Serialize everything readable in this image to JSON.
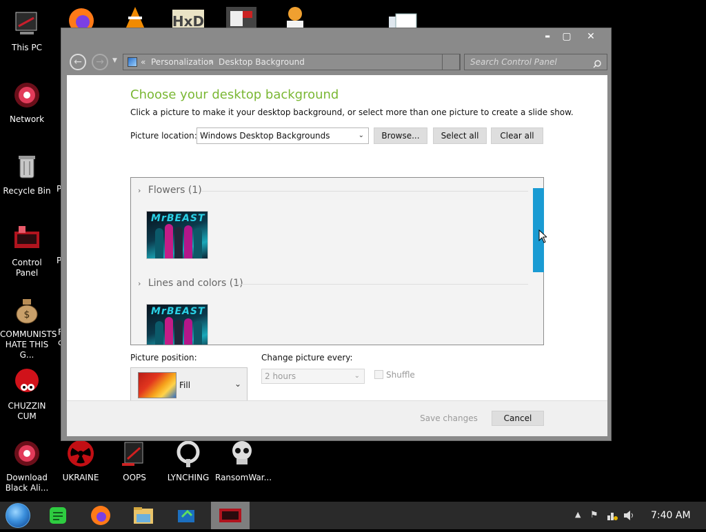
{
  "desktop": {
    "icons": [
      {
        "label": "This PC"
      },
      {
        "label": "Network"
      },
      {
        "label": "Recycle Bin"
      },
      {
        "label": "Control Panel"
      },
      {
        "label": "COMMUNISTS HATE THIS G..."
      },
      {
        "label": "CHUZZIN CUM"
      },
      {
        "label": "Download Black Ali..."
      },
      {
        "label": "UKRAINE"
      },
      {
        "label": "OOPS"
      },
      {
        "label": "LYNCHING"
      },
      {
        "label": "RansomWar..."
      }
    ],
    "cutoff_labels": [
      "P",
      "P",
      "F",
      "c"
    ]
  },
  "window": {
    "controls": {
      "minimize": "▬",
      "maximize": "▢",
      "close": "✕"
    },
    "breadcrumb": {
      "prefix": "«",
      "items": [
        "Personalization",
        "Desktop Background"
      ],
      "separator": "›"
    },
    "search_placeholder": "Search Control Panel",
    "heading": "Choose your desktop background",
    "subheading": "Click a picture to make it your desktop background, or select more than one picture to create a slide show.",
    "picture_location_label": "Picture location:",
    "picture_location_value": "Windows Desktop Backgrounds",
    "buttons": {
      "browse": "Browse...",
      "select_all": "Select all",
      "clear_all": "Clear all"
    },
    "groups": [
      {
        "label": "Flowers (1)",
        "thumb_text": "MrBEAST"
      },
      {
        "label": "Lines and colors (1)",
        "thumb_text": "MrBEAST"
      }
    ],
    "picture_position_label": "Picture position:",
    "picture_position_value": "Fill",
    "change_picture_label": "Change picture every:",
    "change_picture_value": "2 hours",
    "shuffle_label": "Shuffle",
    "save_changes": "Save changes",
    "cancel": "Cancel"
  },
  "taskbar": {
    "clock": "7:40 AM"
  },
  "colors": {
    "heading": "#7ab733",
    "scroll_accent": "#1a9bd3",
    "window_frame": "#8a8a8a",
    "taskbar": "#2a2a2a"
  }
}
